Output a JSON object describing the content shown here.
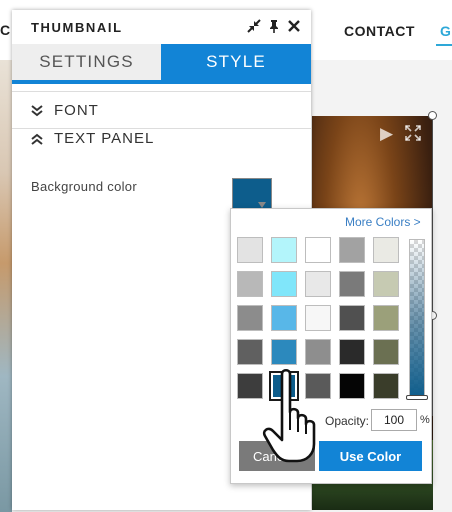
{
  "site": {
    "nav_partial_left": "C",
    "nav_contact": "CONTACT",
    "nav_partial_right": "G"
  },
  "panel": {
    "title": "THUMBNAIL",
    "icons": [
      "collapse-icon",
      "pin-icon",
      "close-icon"
    ],
    "tabs": [
      {
        "label": "SETTINGS",
        "active": false
      },
      {
        "label": "STYLE",
        "active": true
      }
    ],
    "sections": [
      {
        "label": "FONT",
        "expanded": false
      },
      {
        "label": "TEXT PANEL",
        "expanded": true
      }
    ],
    "background_color_label": "Background color",
    "background_color_value": "#0d5d8c"
  },
  "picker": {
    "more_colors": "More Colors >",
    "swatches": [
      [
        "#e3e3e3",
        "#b3f5fb",
        "#ffffff",
        "#a2a2a2",
        "#eaeae4"
      ],
      [
        "#b8b8b8",
        "#80e6fa",
        "#e8e8e8",
        "#7a7a7a",
        "#c6cab2"
      ],
      [
        "#8c8c8c",
        "#58b7e8",
        "#f7f7f7",
        "#505050",
        "#9ba07a"
      ],
      [
        "#606060",
        "#2c89bd",
        "#8e8e8e",
        "#2a2a2a",
        "#6b7052"
      ],
      [
        "#3d3d3d",
        "#0d5d8c",
        "#5a5a5a",
        "#050505",
        "#3a3d2a"
      ]
    ],
    "selected": [
      4,
      1
    ],
    "opacity_label": "Opacity:",
    "opacity_value": "100",
    "opacity_unit": "%",
    "cancel_label": "Cancel",
    "use_color_label": "Use Color"
  },
  "colors": {
    "accent": "#1284d6",
    "link": "#3a7fc4",
    "nav_active": "#2ea8d8"
  }
}
